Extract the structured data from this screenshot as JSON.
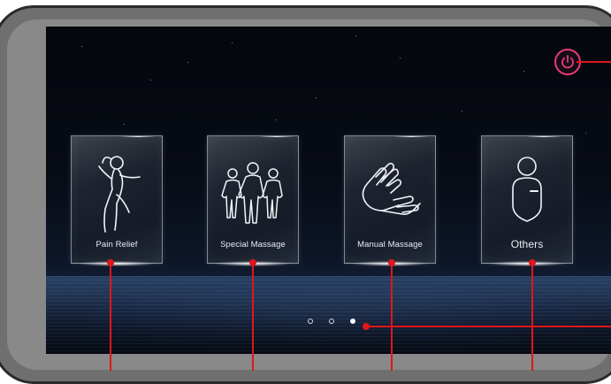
{
  "categories": [
    {
      "id": "pain-relief",
      "label": "Pain Relief",
      "icon": "stretching-person-icon"
    },
    {
      "id": "special-massage",
      "label": "Special Massage",
      "icon": "three-people-icon"
    },
    {
      "id": "manual-massage",
      "label": "Manual Massage",
      "icon": "hands-icon"
    },
    {
      "id": "others",
      "label": "Others",
      "icon": "user-badge-icon"
    }
  ],
  "pagination": {
    "total": 3,
    "active": 3
  },
  "power": {
    "icon": "power-icon",
    "color": "#e83a78"
  },
  "callout_color": "#e0161b"
}
